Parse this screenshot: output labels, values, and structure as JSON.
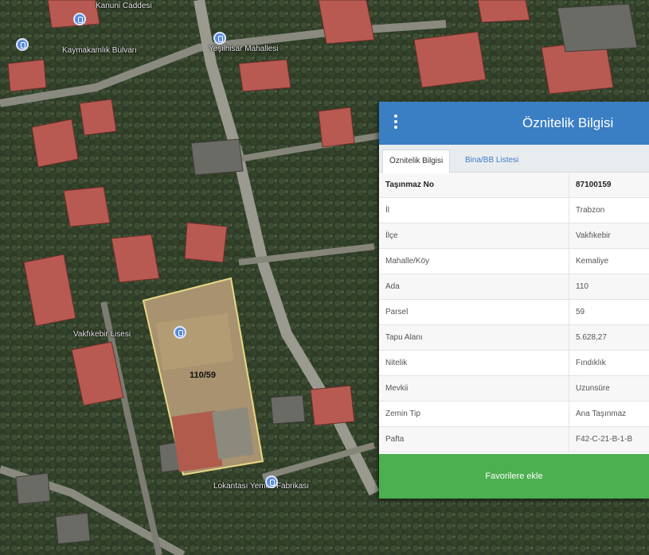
{
  "map": {
    "labels": {
      "top_street": "Kanuni Caddesi",
      "poi_left": "Kaymakamlık Bulvarı",
      "poi_right": "Yeşilhisar Mahallesi",
      "school": "Vakfıkebir Lisesi",
      "parcel": "110/59",
      "cafeteria": "Lokantası Yemek Fabrikası"
    }
  },
  "panel": {
    "title": "Öznitelik Bilgisi",
    "tabs": [
      "Öznitelik Bilgisi",
      "Bina/BB Listesi"
    ],
    "rows": [
      {
        "key": "Taşınmaz No",
        "value": "87100159"
      },
      {
        "key": "İl",
        "value": "Trabzon"
      },
      {
        "key": "İlçe",
        "value": "Vakfıkebir"
      },
      {
        "key": "Mahalle/Köy",
        "value": "Kemaliye"
      },
      {
        "key": "Ada",
        "value": "110"
      },
      {
        "key": "Parsel",
        "value": "59"
      },
      {
        "key": "Tapu Alanı",
        "value": "5.628,27"
      },
      {
        "key": "Nitelik",
        "value": "Fındıklık"
      },
      {
        "key": "Mevkii",
        "value": "Uzunsüre"
      },
      {
        "key": "Zemin Tip",
        "value": "Ana Taşınmaz"
      },
      {
        "key": "Pafta",
        "value": "F42-C-21-B-1-B"
      }
    ],
    "favorite_button": "Favorilere ekle"
  }
}
